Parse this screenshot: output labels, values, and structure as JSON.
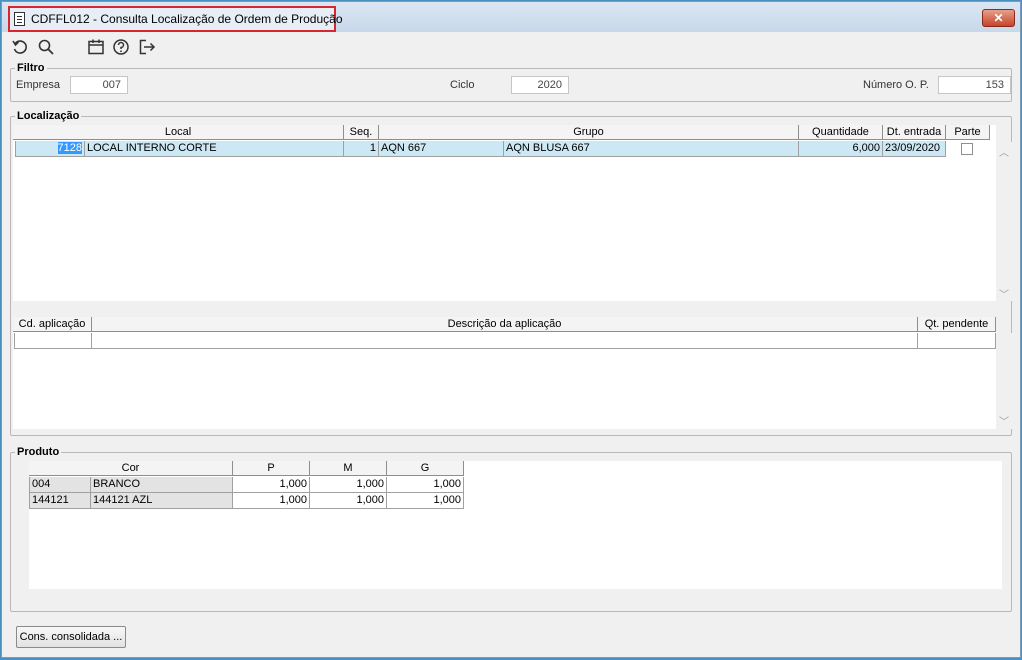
{
  "window": {
    "title": "CDFFL012 - Consulta Localização de Ordem de Produção",
    "close_glyph": "✕"
  },
  "toolbar": {
    "icons": [
      "refresh-icon",
      "search-icon",
      "calendar-icon",
      "help-icon",
      "exit-icon"
    ]
  },
  "filtro": {
    "legend": "Filtro",
    "empresa_label": "Empresa",
    "empresa_value": "007",
    "ciclo_label": "Ciclo",
    "ciclo_value": "2020",
    "numero_op_label": "Número O. P.",
    "numero_op_value": "153"
  },
  "localizacao": {
    "legend": "Localização",
    "columns": [
      "Local",
      "Seq.",
      "Grupo",
      "Quantidade",
      "Dt. entrada",
      "Parte"
    ],
    "rows": [
      {
        "local_code": "7128",
        "local_name": "LOCAL INTERNO CORTE",
        "seq": "1",
        "grupo_code": "AQN 667",
        "grupo_name": "AQN BLUSA 667",
        "quantidade": "6,000",
        "dt_entrada": "23/09/2020",
        "parte": false
      }
    ]
  },
  "aplicacao": {
    "columns": [
      "Cd. aplicação",
      "Descrição da aplicação",
      "Qt. pendente"
    ]
  },
  "produto": {
    "legend": "Produto",
    "columns": [
      "Cor",
      "P",
      "M",
      "G"
    ],
    "rows": [
      {
        "code": "004",
        "name": "BRANCO",
        "p": "1,000",
        "m": "1,000",
        "g": "1,000"
      },
      {
        "code": "144121",
        "name": "144121 AZL",
        "p": "1,000",
        "m": "1,000",
        "g": "1,000"
      }
    ]
  },
  "footer": {
    "cons_button": "Cons. consolidada ..."
  },
  "colors": {
    "selection": "#cde8f5",
    "highlight_cell": "#3399ff",
    "title_frame": "#d9262d"
  }
}
